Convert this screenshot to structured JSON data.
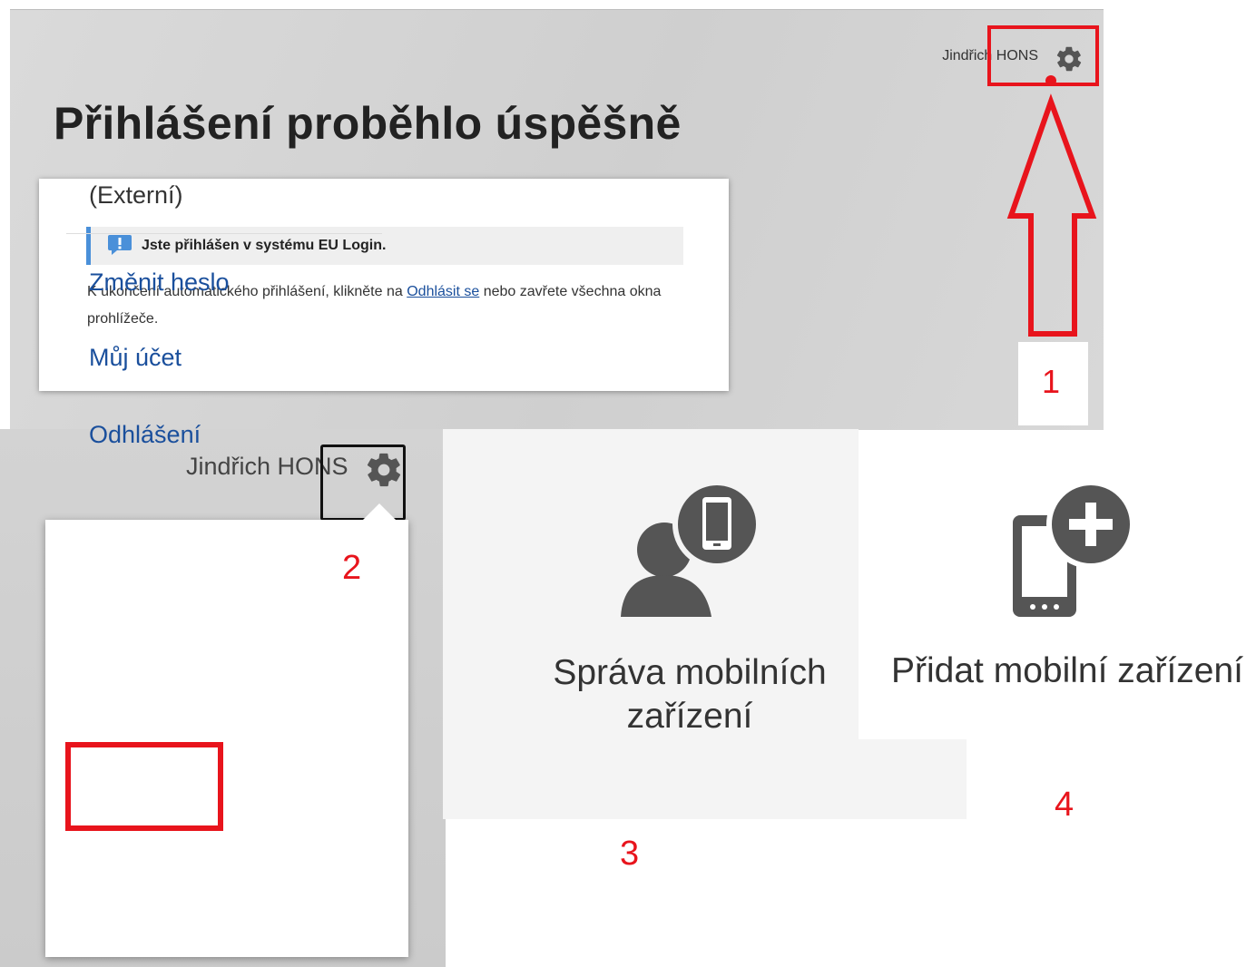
{
  "colors": {
    "annotation_red": "#e8141c",
    "link_blue": "#1a4f9c",
    "notice_blue": "#4a90d9",
    "icon_gray": "#555555"
  },
  "panel1": {
    "user_name": "Jindřich HONS",
    "gear_icon": "gear-icon",
    "title": "Přihlášení proběhlo úspěšně",
    "notice": {
      "icon": "exclamation-icon",
      "text": "Jste přihlášen v systému EU Login."
    },
    "message": {
      "before": "K ukončení automatického přihlášení, klikněte na ",
      "link": "Odhlásit se",
      "after": " nebo zavřete všechna okna prohlížeče."
    },
    "annotation_number": "1"
  },
  "panel2": {
    "user_name": "Jindřich HONS",
    "gear_icon": "gear-icon",
    "annotation_number": "2",
    "menu": {
      "role": "(Externí)",
      "items": [
        {
          "label": "Změnit heslo"
        },
        {
          "label": "Můj účet"
        },
        {
          "label": "Odhlášení"
        }
      ]
    }
  },
  "panel3": {
    "icon": "user-mobile-icon",
    "title_line1": "Správa mobilních",
    "title_line2": "zařízení",
    "annotation_number": "3"
  },
  "panel4": {
    "icon": "add-mobile-icon",
    "title": "Přidat mobilní zařízení",
    "annotation_number": "4"
  }
}
